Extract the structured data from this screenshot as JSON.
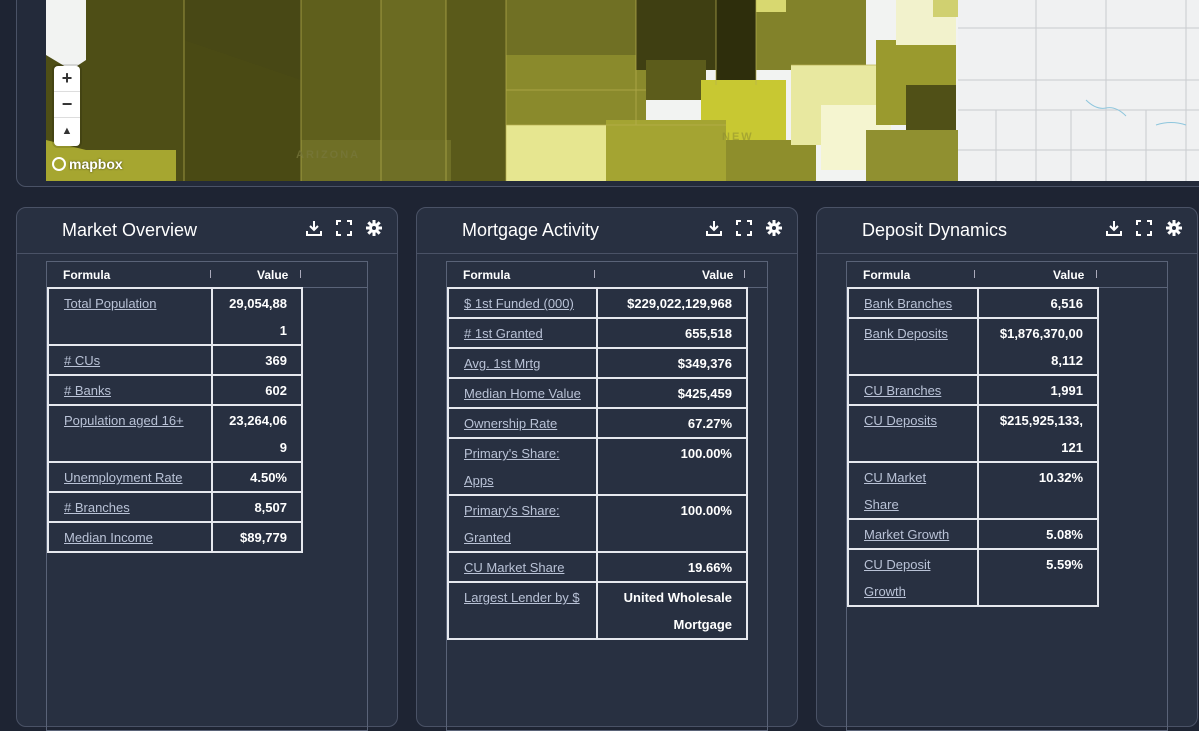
{
  "map": {
    "state_label": "ARIZONA",
    "state_label_2": "NEW",
    "zoom_in": "+",
    "zoom_out": "−",
    "compass": "▲",
    "attribution": "mapbox"
  },
  "widgets": [
    {
      "title": "Market Overview",
      "header_formula": "Formula",
      "header_value": "Value",
      "rows": [
        {
          "formula": "Total Population",
          "value": "29,054,881"
        },
        {
          "formula": "# CUs",
          "value": "369"
        },
        {
          "formula": "# Banks",
          "value": "602"
        },
        {
          "formula": "Population aged 16+",
          "value": "23,264,069"
        },
        {
          "formula": "Unemployment Rate",
          "value": "4.50%"
        },
        {
          "formula": "# Branches",
          "value": "8,507"
        },
        {
          "formula": "Median Income",
          "value": "$89,779"
        }
      ]
    },
    {
      "title": "Mortgage Activity",
      "header_formula": "Formula",
      "header_value": "Value",
      "rows": [
        {
          "formula": "$ 1st Funded (000)",
          "value": "$229,022,129,968"
        },
        {
          "formula": "# 1st Granted",
          "value": "655,518"
        },
        {
          "formula": "Avg. 1st Mrtg",
          "value": "$349,376"
        },
        {
          "formula": "Median Home Value",
          "value": "$425,459"
        },
        {
          "formula": "Ownership Rate",
          "value": "67.27%"
        },
        {
          "formula": "Primary's Share: Apps",
          "value": "100.00%"
        },
        {
          "formula": "Primary's Share: Granted",
          "value": "100.00%"
        },
        {
          "formula": "CU Market Share",
          "value": "19.66%"
        },
        {
          "formula": "Largest Lender by $",
          "value": "United Wholesale Mortgage"
        }
      ]
    },
    {
      "title": "Deposit Dynamics",
      "header_formula": "Formula",
      "header_value": "Value",
      "rows": [
        {
          "formula": "Bank Branches",
          "value": "6,516"
        },
        {
          "formula": "Bank Deposits",
          "value": "$1,876,370,008,112"
        },
        {
          "formula": "CU Branches",
          "value": "1,991"
        },
        {
          "formula": "CU Deposits",
          "value": "$215,925,133,121"
        },
        {
          "formula": "CU Market Share",
          "value": "10.32%"
        },
        {
          "formula": "Market Growth",
          "value": "5.08%"
        },
        {
          "formula": "CU Deposit Growth",
          "value": "5.59%"
        }
      ]
    }
  ],
  "icons": [
    "download-icon",
    "fullscreen-icon",
    "gear-icon"
  ]
}
